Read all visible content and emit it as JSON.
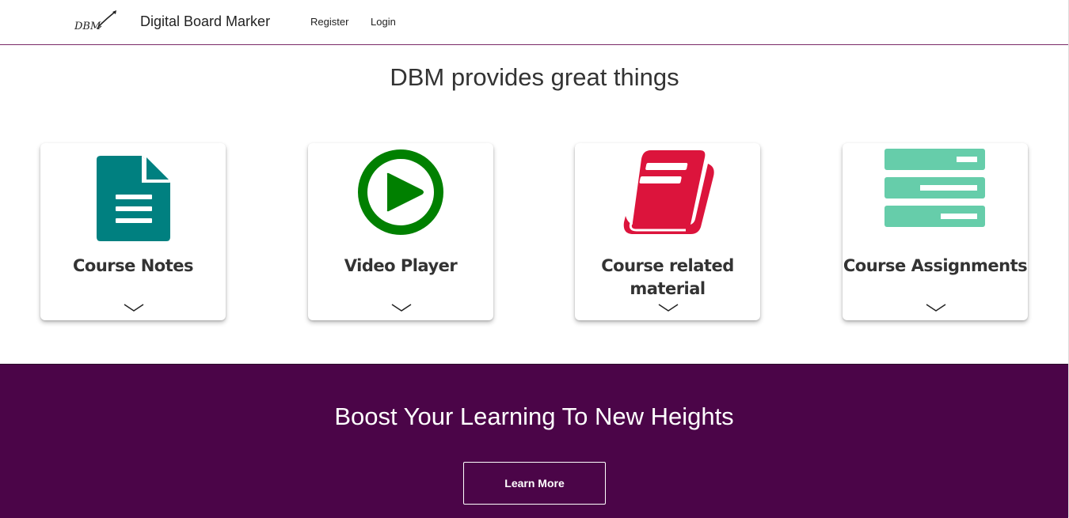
{
  "navbar": {
    "logo_text": "DBM",
    "brand": "Digital Board Marker",
    "links": [
      "Register",
      "Login"
    ]
  },
  "headline": "DBM provides great things",
  "cards": [
    {
      "title": "Course Notes",
      "icon": "document-icon",
      "color": "#008080"
    },
    {
      "title": "Video Player",
      "icon": "play-circle-icon",
      "color": "#008000"
    },
    {
      "title": "Course related material",
      "icon": "book-icon",
      "color": "#dc143c"
    },
    {
      "title": "Course Assignments",
      "icon": "list-bars-icon",
      "color": "#66cdaa"
    }
  ],
  "banner": {
    "title": "Boost Your Learning To New Heights",
    "button": "Learn More",
    "background": "#4b0548"
  }
}
